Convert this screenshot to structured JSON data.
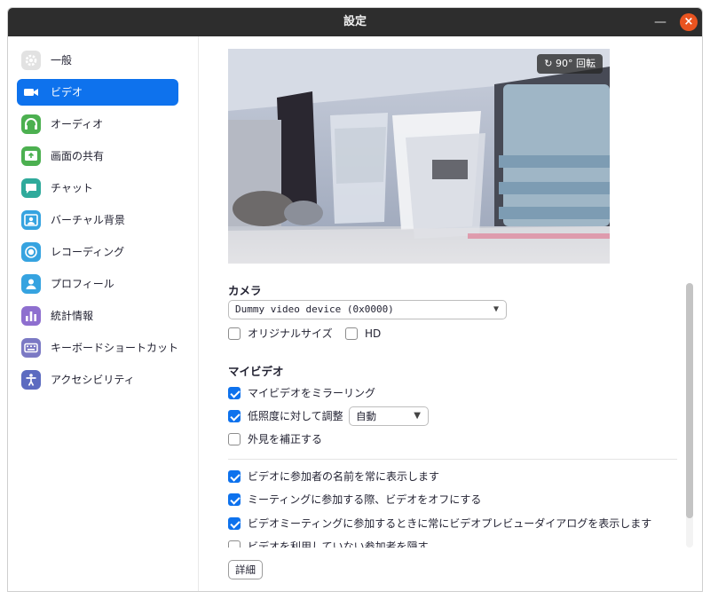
{
  "window": {
    "title": "設定"
  },
  "sidebar": {
    "items": [
      {
        "label": "一般",
        "icon": "gear-icon",
        "color": "#d9d9d9"
      },
      {
        "label": "ビデオ",
        "icon": "video-camera-icon",
        "color": "#0e72ed",
        "active": true
      },
      {
        "label": "オーディオ",
        "icon": "headphones-icon",
        "color": "#4cb050"
      },
      {
        "label": "画面の共有",
        "icon": "share-screen-icon",
        "color": "#4cb050"
      },
      {
        "label": "チャット",
        "icon": "chat-bubble-icon",
        "color": "#2faa9b"
      },
      {
        "label": "バーチャル背景",
        "icon": "virtual-background-icon",
        "color": "#36a3e0"
      },
      {
        "label": "レコーディング",
        "icon": "record-icon",
        "color": "#36a3e0"
      },
      {
        "label": "プロフィール",
        "icon": "profile-icon",
        "color": "#36a3e0"
      },
      {
        "label": "統計情報",
        "icon": "statistics-icon",
        "color": "#8e6fcf"
      },
      {
        "label": "キーボードショートカット",
        "icon": "keyboard-icon",
        "color": "#7b79c4"
      },
      {
        "label": "アクセシビリティ",
        "icon": "accessibility-icon",
        "color": "#5c6bc0"
      }
    ]
  },
  "preview": {
    "rotate_label": "90° 回転"
  },
  "camera": {
    "title": "カメラ",
    "device": "Dummy video device (0x0000)",
    "original_size": {
      "label": "オリジナルサイズ",
      "checked": false
    },
    "hd": {
      "label": "HD",
      "checked": false
    }
  },
  "my_video": {
    "title": "マイビデオ",
    "mirror": {
      "label": "マイビデオをミラーリング",
      "checked": true
    },
    "low_light": {
      "label": "低照度に対して調整",
      "checked": true,
      "mode": "自動"
    },
    "touch_up": {
      "label": "外見を補正する",
      "checked": false
    }
  },
  "options": [
    {
      "label": "ビデオに参加者の名前を常に表示します",
      "checked": true
    },
    {
      "label": "ミーティングに参加する際、ビデオをオフにする",
      "checked": true
    },
    {
      "label": "ビデオミーティングに参加するときに常にビデオプレビューダイアログを表示します",
      "checked": true
    },
    {
      "label": "ビデオを利用していない参加者を隠す",
      "checked": false
    }
  ],
  "detail_label": "詳細",
  "colors": {
    "accent": "#0e72ed",
    "close": "#e95420",
    "titlebar": "#2d2d2d"
  }
}
